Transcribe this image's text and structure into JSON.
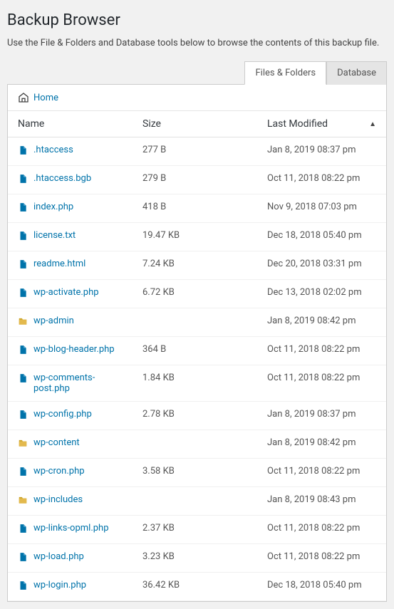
{
  "header": {
    "title": "Backup Browser",
    "description": "Use the File & Folders and Database tools below to browse the contents of this backup file."
  },
  "tabs": [
    {
      "label": "Files & Folders",
      "active": true
    },
    {
      "label": "Database",
      "active": false
    }
  ],
  "breadcrumb": {
    "home_label": "Home"
  },
  "columns": {
    "name": "Name",
    "size": "Size",
    "modified": "Last Modified"
  },
  "sort": {
    "column": "modified",
    "direction": "asc"
  },
  "rows": [
    {
      "type": "file",
      "name": ".htaccess",
      "size": "277 B",
      "modified": "Jan 8, 2019 08:37 pm"
    },
    {
      "type": "file",
      "name": ".htaccess.bgb",
      "size": "279 B",
      "modified": "Oct 11, 2018 08:22 pm"
    },
    {
      "type": "file",
      "name": "index.php",
      "size": "418 B",
      "modified": "Nov 9, 2018 07:03 pm"
    },
    {
      "type": "file",
      "name": "license.txt",
      "size": "19.47 KB",
      "modified": "Dec 18, 2018 05:40 pm"
    },
    {
      "type": "file",
      "name": "readme.html",
      "size": "7.24 KB",
      "modified": "Dec 20, 2018 03:31 pm"
    },
    {
      "type": "file",
      "name": "wp-activate.php",
      "size": "6.72 KB",
      "modified": "Dec 13, 2018 02:02 pm"
    },
    {
      "type": "folder",
      "name": "wp-admin",
      "size": "",
      "modified": "Jan 8, 2019 08:42 pm"
    },
    {
      "type": "file",
      "name": "wp-blog-header.php",
      "size": "364 B",
      "modified": "Oct 11, 2018 08:22 pm"
    },
    {
      "type": "file",
      "name": "wp-comments-post.php",
      "size": "1.84 KB",
      "modified": "Oct 11, 2018 08:22 pm"
    },
    {
      "type": "file",
      "name": "wp-config.php",
      "size": "2.78 KB",
      "modified": "Jan 8, 2019 08:37 pm"
    },
    {
      "type": "folder",
      "name": "wp-content",
      "size": "",
      "modified": "Jan 8, 2019 08:42 pm"
    },
    {
      "type": "file",
      "name": "wp-cron.php",
      "size": "3.58 KB",
      "modified": "Oct 11, 2018 08:22 pm"
    },
    {
      "type": "folder",
      "name": "wp-includes",
      "size": "",
      "modified": "Jan 8, 2019 08:43 pm"
    },
    {
      "type": "file",
      "name": "wp-links-opml.php",
      "size": "2.37 KB",
      "modified": "Oct 11, 2018 08:22 pm"
    },
    {
      "type": "file",
      "name": "wp-load.php",
      "size": "3.23 KB",
      "modified": "Oct 11, 2018 08:22 pm"
    },
    {
      "type": "file",
      "name": "wp-login.php",
      "size": "36.42 KB",
      "modified": "Dec 18, 2018 05:40 pm"
    }
  ]
}
